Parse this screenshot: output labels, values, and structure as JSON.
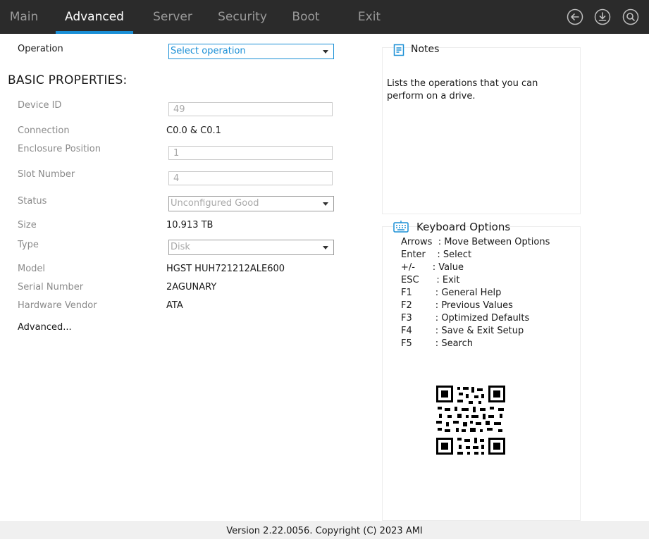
{
  "topbar": {
    "tabs": [
      {
        "label": "Main"
      },
      {
        "label": "Advanced"
      },
      {
        "label": "Server"
      },
      {
        "label": "Security"
      },
      {
        "label": "Boot"
      },
      {
        "label": "Exit"
      }
    ],
    "active_tab": "Advanced",
    "icons": [
      "back-icon",
      "save-icon",
      "search-icon"
    ],
    "accent_color": "#1a8fd6"
  },
  "form": {
    "operation": {
      "label": "Operation",
      "value": "Select operation"
    },
    "section_title": "BASIC PROPERTIES:",
    "device_id": {
      "label": "Device ID",
      "value": "49"
    },
    "connection": {
      "label": "Connection",
      "value": "C0.0 & C0.1"
    },
    "enclosure_position": {
      "label": "Enclosure Position",
      "value": "1"
    },
    "slot_number": {
      "label": "Slot Number",
      "value": "4"
    },
    "status": {
      "label": "Status",
      "value": "Unconfigured Good"
    },
    "size": {
      "label": "Size",
      "value": "10.913 TB"
    },
    "type": {
      "label": "Type",
      "value": "Disk"
    },
    "model": {
      "label": "Model",
      "value": "HGST HUH721212ALE600"
    },
    "serial_number": {
      "label": "Serial Number",
      "value": "2AGUNARY"
    },
    "hardware_vendor": {
      "label": "Hardware Vendor",
      "value": "ATA"
    },
    "advanced_link": "Advanced..."
  },
  "notes": {
    "title": "Notes",
    "text": "Lists the operations that you can perform on a drive."
  },
  "keyboard": {
    "title": "Keyboard Options",
    "rows": [
      "Arrows  : Move Between Options",
      "Enter    : Select",
      "+/-      : Value",
      "ESC      : Exit",
      "F1        : General Help",
      "F2        : Previous Values",
      "F3        : Optimized Defaults",
      "F4        : Save & Exit Setup",
      "F5        : Search"
    ]
  },
  "footer": {
    "text": "Version 2.22.0056. Copyright (C) 2023 AMI"
  }
}
